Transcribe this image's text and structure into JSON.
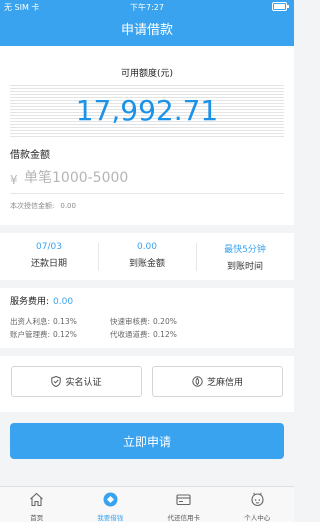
{
  "status": {
    "carrier": "无 SIM 卡",
    "time": "下午7:27"
  },
  "nav": {
    "title": "申请借款"
  },
  "credit": {
    "label": "可用额度(元)",
    "amount": "17,992.71"
  },
  "borrow": {
    "label": "借款金额",
    "currency": "¥",
    "placeholder": "单笔1000-5000",
    "credit_line_label": "本次授信金额:",
    "credit_line_value": "0.00"
  },
  "stats": [
    {
      "value": "07/03",
      "label": "还款日期"
    },
    {
      "value": "0.00",
      "label": "到账金额"
    },
    {
      "value": "最快5分钟",
      "label": "到账时间"
    }
  ],
  "fees": {
    "title": "服务费用:",
    "total": "0.00",
    "items": [
      {
        "label": "出资人利息:",
        "value": "0.13%"
      },
      {
        "label": "快速审核费:",
        "value": "0.20%"
      },
      {
        "label": "账户管理费:",
        "value": "0.12%"
      },
      {
        "label": "代收通道费:",
        "value": "0.12%"
      }
    ]
  },
  "actions": {
    "verify": "实名认证",
    "sesame": "芝麻信用",
    "apply": "立即申请"
  },
  "tabs": [
    {
      "label": "首页",
      "icon": "home-icon"
    },
    {
      "label": "我要借钱",
      "icon": "borrow-icon"
    },
    {
      "label": "代还信用卡",
      "icon": "credit-card-icon"
    },
    {
      "label": "个人中心",
      "icon": "user-icon"
    }
  ],
  "colors": {
    "accent": "#3aa3ef",
    "amount": "#1a92e8"
  }
}
